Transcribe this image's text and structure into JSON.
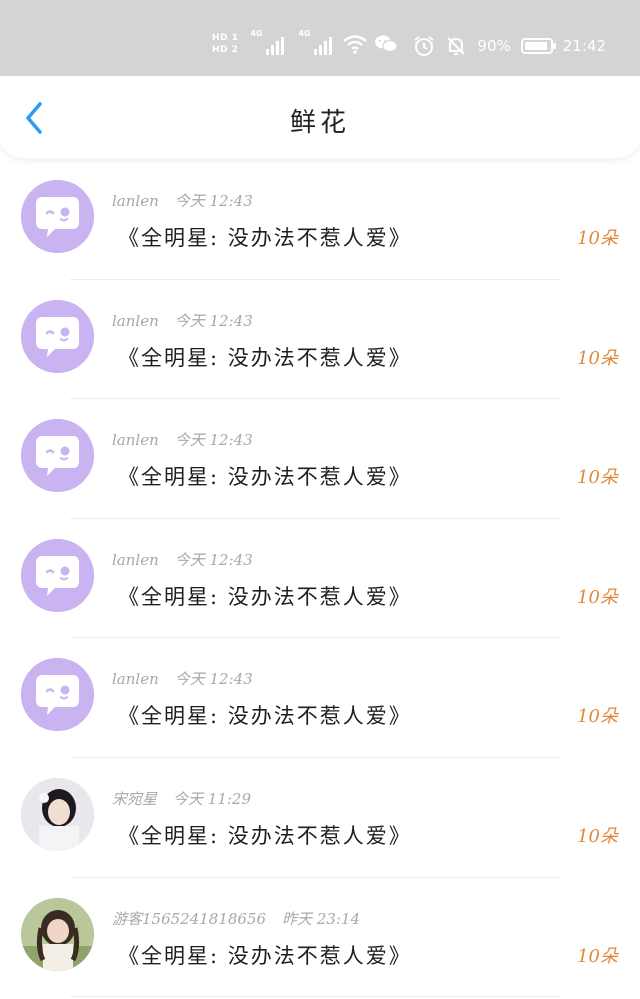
{
  "status_bar": {
    "sim1": "HD 1",
    "sim2": "HD 2",
    "net1": "4G",
    "net2": "4G",
    "battery_percent": "90%",
    "time": "21:42",
    "battery_level": 0.9
  },
  "header": {
    "title": "鲜花"
  },
  "records": [
    {
      "user": "lanlen",
      "time": "今天 12:43",
      "gift": "《全明星: 没办法不惹人爱》",
      "count": "10朵",
      "avatar": "chat-bubble-icon"
    },
    {
      "user": "lanlen",
      "time": "今天 12:43",
      "gift": "《全明星: 没办法不惹人爱》",
      "count": "10朵",
      "avatar": "chat-bubble-icon"
    },
    {
      "user": "lanlen",
      "time": "今天 12:43",
      "gift": "《全明星: 没办法不惹人爱》",
      "count": "10朵",
      "avatar": "chat-bubble-icon"
    },
    {
      "user": "lanlen",
      "time": "今天 12:43",
      "gift": "《全明星: 没办法不惹人爱》",
      "count": "10朵",
      "avatar": "chat-bubble-icon"
    },
    {
      "user": "lanlen",
      "time": "今天 12:43",
      "gift": "《全明星: 没办法不惹人爱》",
      "count": "10朵",
      "avatar": "chat-bubble-icon"
    },
    {
      "user": "宋宛星",
      "time": "今天 11:29",
      "gift": "《全明星: 没办法不惹人爱》",
      "count": "10朵",
      "avatar": "user-photo-1"
    },
    {
      "user": "游客1565241818656",
      "time": "昨天 23:14",
      "gift": "《全明星: 没办法不惹人爱》",
      "count": "10朵",
      "avatar": "user-photo-2"
    }
  ],
  "colors": {
    "status_bar_bg": "#d4d4d4",
    "back_arrow": "#2b9bf4",
    "avatar_bg": "#c9b3f0",
    "count_text": "#e0883a",
    "meta_text": "#a8a8a8"
  }
}
